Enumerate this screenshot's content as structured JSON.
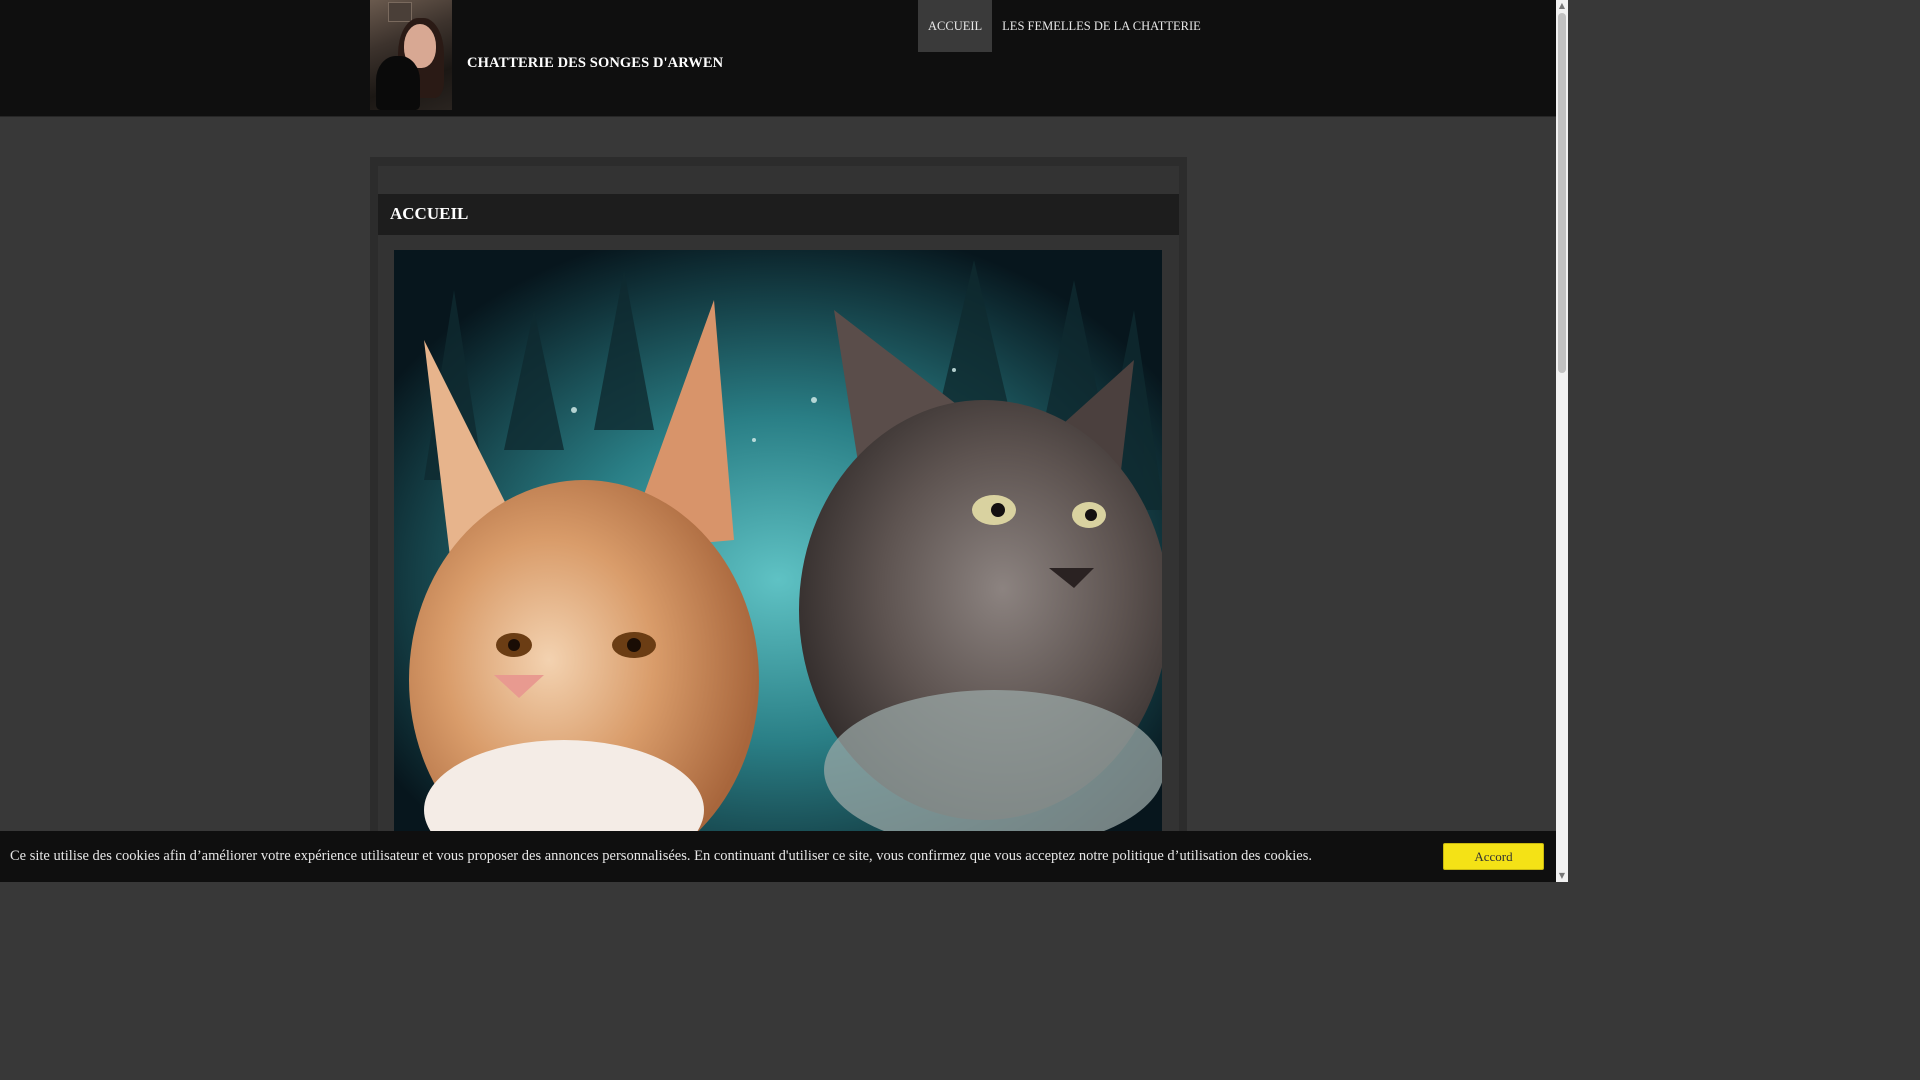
{
  "header": {
    "site_title": "CHATTERIE DES SONGES D'ARWEN",
    "nav": [
      {
        "label": "ACCUEIL",
        "active": true
      },
      {
        "label": "LES FEMELLES DE LA CHATTERIE",
        "active": false
      }
    ]
  },
  "main": {
    "heading": "ACCUEIL"
  },
  "cookie": {
    "text": "Ce site utilise des cookies afin d’améliorer votre expérience utilisateur et vous proposer des annonces personnalisées. En continuant d'utiliser ce site, vous confirmez que vous acceptez notre politique d’utilisation des cookies.",
    "button_label": "Accord"
  },
  "colors": {
    "header_bg": "#0f0f0f",
    "page_bg": "#383838",
    "accent_button": "#f4e216"
  }
}
